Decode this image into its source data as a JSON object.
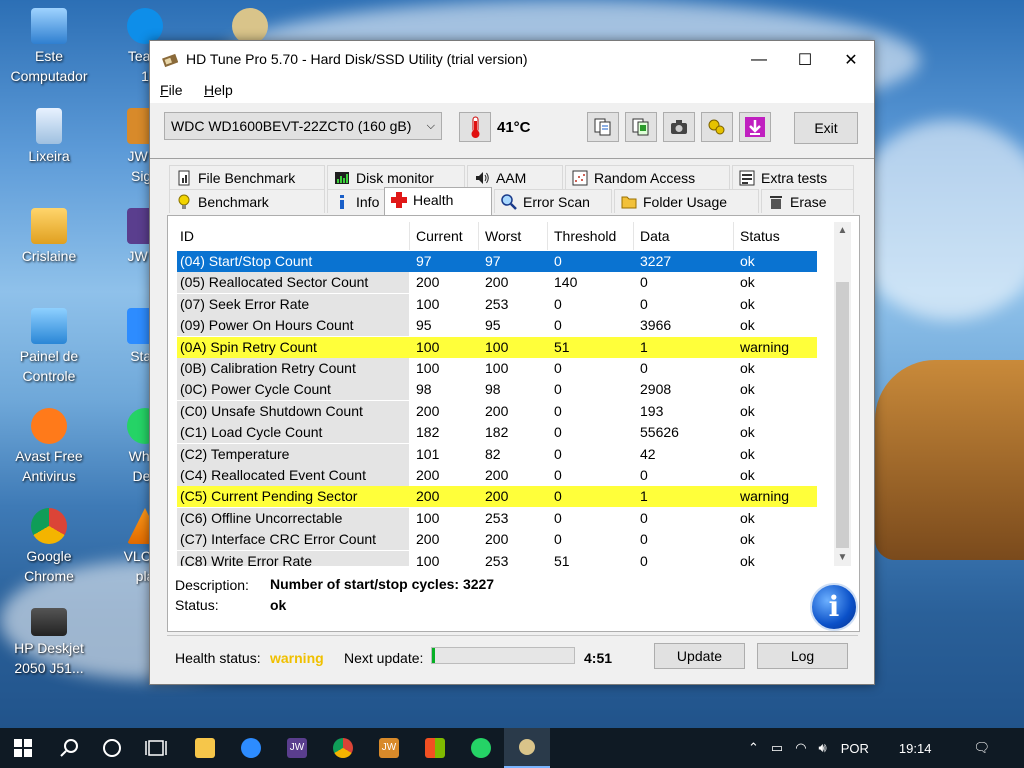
{
  "window": {
    "title": "HD Tune Pro 5.70 - Hard Disk/SSD Utility (trial version)",
    "minimize": "—",
    "maximize": "☐",
    "close": "✕"
  },
  "menu": [
    {
      "label": "File",
      "underline": "F",
      "rest": "ile"
    },
    {
      "label": "Help",
      "underline": "H",
      "rest": "elp"
    }
  ],
  "toolbar": {
    "drive": "WDC WD1600BEVT-22ZCT0 (160 gB)",
    "temperature": "41°C",
    "exit": "Exit",
    "icons": [
      "copy-info-icon",
      "copy-screen-icon",
      "camera-icon",
      "options-icon",
      "save-icon"
    ]
  },
  "tabs_top": [
    "File Benchmark",
    "Disk monitor",
    "AAM",
    "Random Access",
    "Extra tests"
  ],
  "tabs_bottom": [
    "Benchmark",
    "Info",
    "Health",
    "Error Scan",
    "Folder Usage",
    "Erase"
  ],
  "active_tab": "Health",
  "table": {
    "columns": [
      "ID",
      "Current",
      "Worst",
      "Threshold",
      "Data",
      "Status"
    ],
    "rows": [
      {
        "id": "(04) Start/Stop Count",
        "current": "97",
        "worst": "97",
        "threshold": "0",
        "data": "3227",
        "status": "ok"
      },
      {
        "id": "(05) Reallocated Sector Count",
        "current": "200",
        "worst": "200",
        "threshold": "140",
        "data": "0",
        "status": "ok"
      },
      {
        "id": "(07) Seek Error Rate",
        "current": "100",
        "worst": "253",
        "threshold": "0",
        "data": "0",
        "status": "ok"
      },
      {
        "id": "(09) Power On Hours Count",
        "current": "95",
        "worst": "95",
        "threshold": "0",
        "data": "3966",
        "status": "ok"
      },
      {
        "id": "(0A) Spin Retry Count",
        "current": "100",
        "worst": "100",
        "threshold": "51",
        "data": "1",
        "status": "warning"
      },
      {
        "id": "(0B) Calibration Retry Count",
        "current": "100",
        "worst": "100",
        "threshold": "0",
        "data": "0",
        "status": "ok"
      },
      {
        "id": "(0C) Power Cycle Count",
        "current": "98",
        "worst": "98",
        "threshold": "0",
        "data": "2908",
        "status": "ok"
      },
      {
        "id": "(C0) Unsafe Shutdown Count",
        "current": "200",
        "worst": "200",
        "threshold": "0",
        "data": "193",
        "status": "ok"
      },
      {
        "id": "(C1) Load Cycle Count",
        "current": "182",
        "worst": "182",
        "threshold": "0",
        "data": "55626",
        "status": "ok"
      },
      {
        "id": "(C2) Temperature",
        "current": "101",
        "worst": "82",
        "threshold": "0",
        "data": "42",
        "status": "ok"
      },
      {
        "id": "(C4) Reallocated Event Count",
        "current": "200",
        "worst": "200",
        "threshold": "0",
        "data": "0",
        "status": "ok"
      },
      {
        "id": "(C5) Current Pending Sector",
        "current": "200",
        "worst": "200",
        "threshold": "0",
        "data": "1",
        "status": "warning"
      },
      {
        "id": "(C6) Offline Uncorrectable",
        "current": "100",
        "worst": "253",
        "threshold": "0",
        "data": "0",
        "status": "ok"
      },
      {
        "id": "(C7) Interface CRC Error Count",
        "current": "200",
        "worst": "200",
        "threshold": "0",
        "data": "0",
        "status": "ok"
      },
      {
        "id": "(C8) Write Error Rate",
        "current": "100",
        "worst": "253",
        "threshold": "51",
        "data": "0",
        "status": "ok"
      }
    ]
  },
  "description": {
    "desc_label": "Description:",
    "desc_value": "Number of start/stop cycles: 3227",
    "status_label": "Status:",
    "status_value": "ok"
  },
  "statusbar": {
    "health_label": "Health status:",
    "health_value": "warning",
    "next_update_label": "Next update:",
    "countdown": "4:51",
    "progress_fraction": 0.02,
    "update_button": "Update",
    "log_button": "Log"
  },
  "desktop_icons": [
    {
      "label": "Este\nComputador",
      "icon": "computer-icon"
    },
    {
      "label": "Lixeira",
      "icon": "recycle-bin-icon"
    },
    {
      "label": "Crislaine",
      "icon": "user-folder-icon"
    },
    {
      "label": "Painel de\nControle",
      "icon": "control-panel-icon"
    },
    {
      "label": "Avast Free\nAntivirus",
      "icon": "avast-icon"
    },
    {
      "label": "Google\nChrome",
      "icon": "chrome-icon"
    },
    {
      "label": "HP Deskjet\n2050 J51...",
      "icon": "printer-icon"
    },
    {
      "label": "Team\n1",
      "icon": "teamviewer-icon"
    },
    {
      "label": "JW Li\nSign",
      "icon": "jw-library-sign-icon"
    },
    {
      "label": "JW Li",
      "icon": "jw-library-icon"
    },
    {
      "label": "Start",
      "icon": "zoom-icon"
    },
    {
      "label": "What\nDes",
      "icon": "whatsapp-icon"
    },
    {
      "label": "VLC m\npla",
      "icon": "vlc-icon"
    }
  ],
  "taskbar": {
    "language": "POR",
    "clock": "19:14",
    "app_icons": [
      "windows-start-icon",
      "search-icon",
      "cortana-icon",
      "task-view-icon",
      "file-explorer-icon",
      "zoom-icon",
      "jw-library-icon",
      "chrome-icon",
      "jw-sign-icon",
      "store-icon",
      "whatsapp-icon",
      "hdtune-icon"
    ],
    "jw_label": "JW"
  },
  "colors": {
    "selected_row": "#0a73d1",
    "warning_row": "#ffff3a",
    "warning_text": "#f0c000",
    "progress": "#06b025"
  }
}
